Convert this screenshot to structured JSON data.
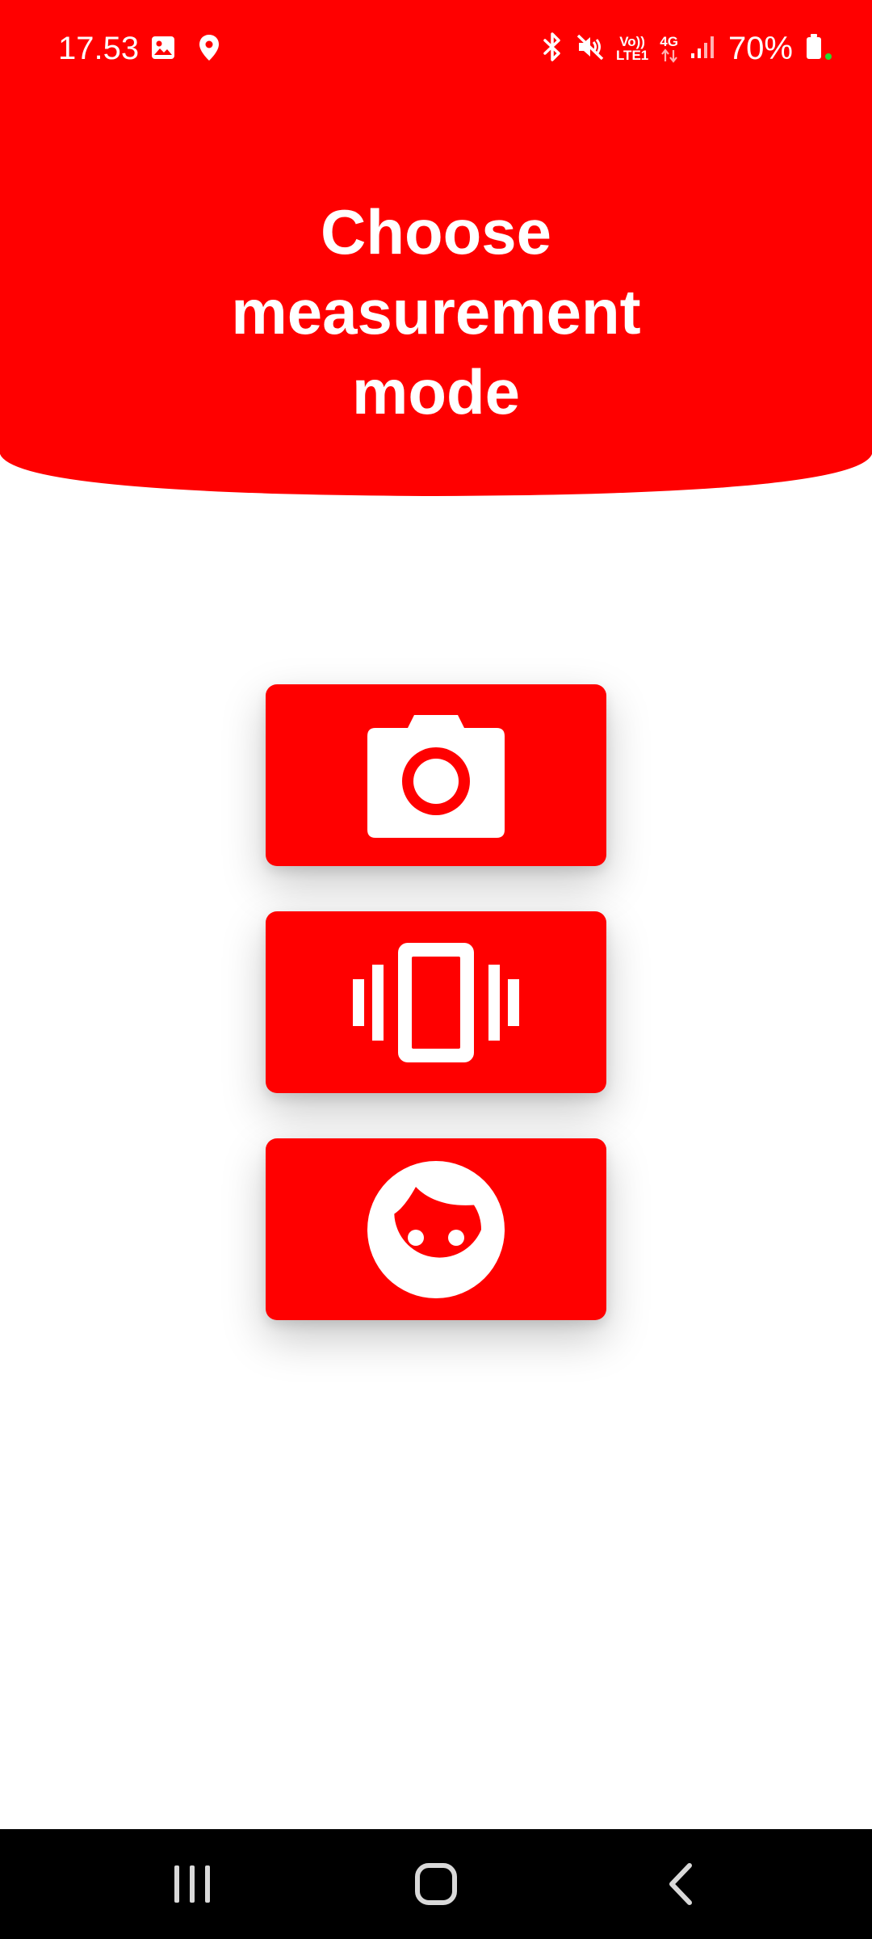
{
  "status_bar": {
    "time": "17.53",
    "battery_percent": "70%",
    "volte_label_top": "Vo))",
    "volte_label_bottom": "LTE1",
    "network_label": "4G",
    "icons": [
      "gallery-icon",
      "location-icon",
      "bluetooth-icon",
      "mute-icon",
      "volte-icon",
      "network-4g-icon",
      "signal-icon",
      "battery-icon"
    ]
  },
  "header": {
    "title_line1": "Choose",
    "title_line2": "measurement",
    "title_line3": "mode",
    "color": "#ff0000"
  },
  "modes": [
    {
      "icon": "camera-icon"
    },
    {
      "icon": "vibration-icon"
    },
    {
      "icon": "face-icon"
    }
  ],
  "nav_bar": {
    "buttons": [
      "recent-apps",
      "home",
      "back"
    ]
  },
  "colors": {
    "accent": "#ff0000",
    "background": "#ffffff",
    "nav_background": "#000000"
  }
}
